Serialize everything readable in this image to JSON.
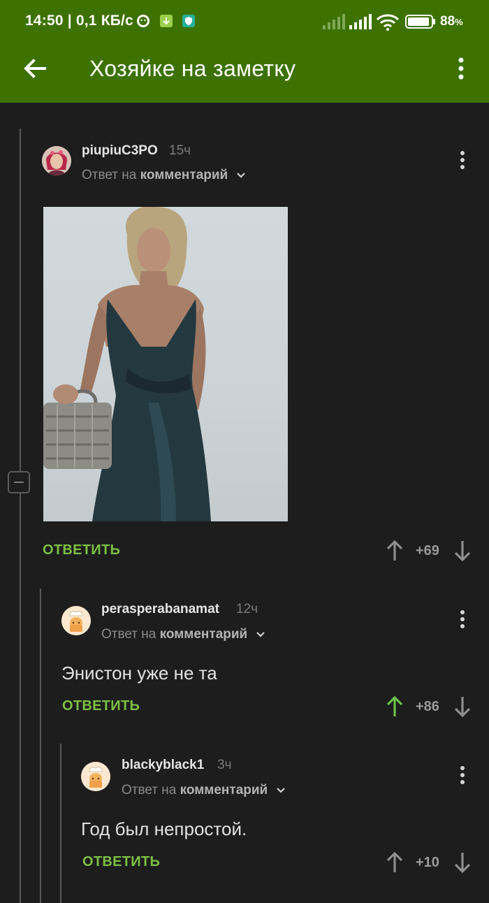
{
  "status_bar": {
    "time": "14:50",
    "speed": "0,1 КБ/с",
    "battery": "88"
  },
  "toolbar": {
    "title": "Хозяйке на заметку"
  },
  "comments": [
    {
      "username": "piupiuC3PO",
      "time": "15ч",
      "reply_prefix": "Ответ на",
      "reply_target": "комментарий",
      "reply_label": "ОТВЕТИТЬ",
      "score": "+69",
      "has_image": true
    },
    {
      "username": "perasperabanamat",
      "time": "12ч",
      "reply_prefix": "Ответ на",
      "reply_target": "комментарий",
      "text": "Энистон уже не та",
      "reply_label": "ОТВЕТИТЬ",
      "score": "+86",
      "upvoted": true
    },
    {
      "username": "blackyblack1",
      "time": "3ч",
      "reply_prefix": "Ответ на",
      "reply_target": "комментарий",
      "text": "Год был непростой.",
      "reply_label": "ОТВЕТИТЬ",
      "score": "+10"
    }
  ],
  "colors": {
    "app_bar": "#3d7200",
    "background": "#1d1d1d",
    "accent_green": "#7cc043"
  }
}
